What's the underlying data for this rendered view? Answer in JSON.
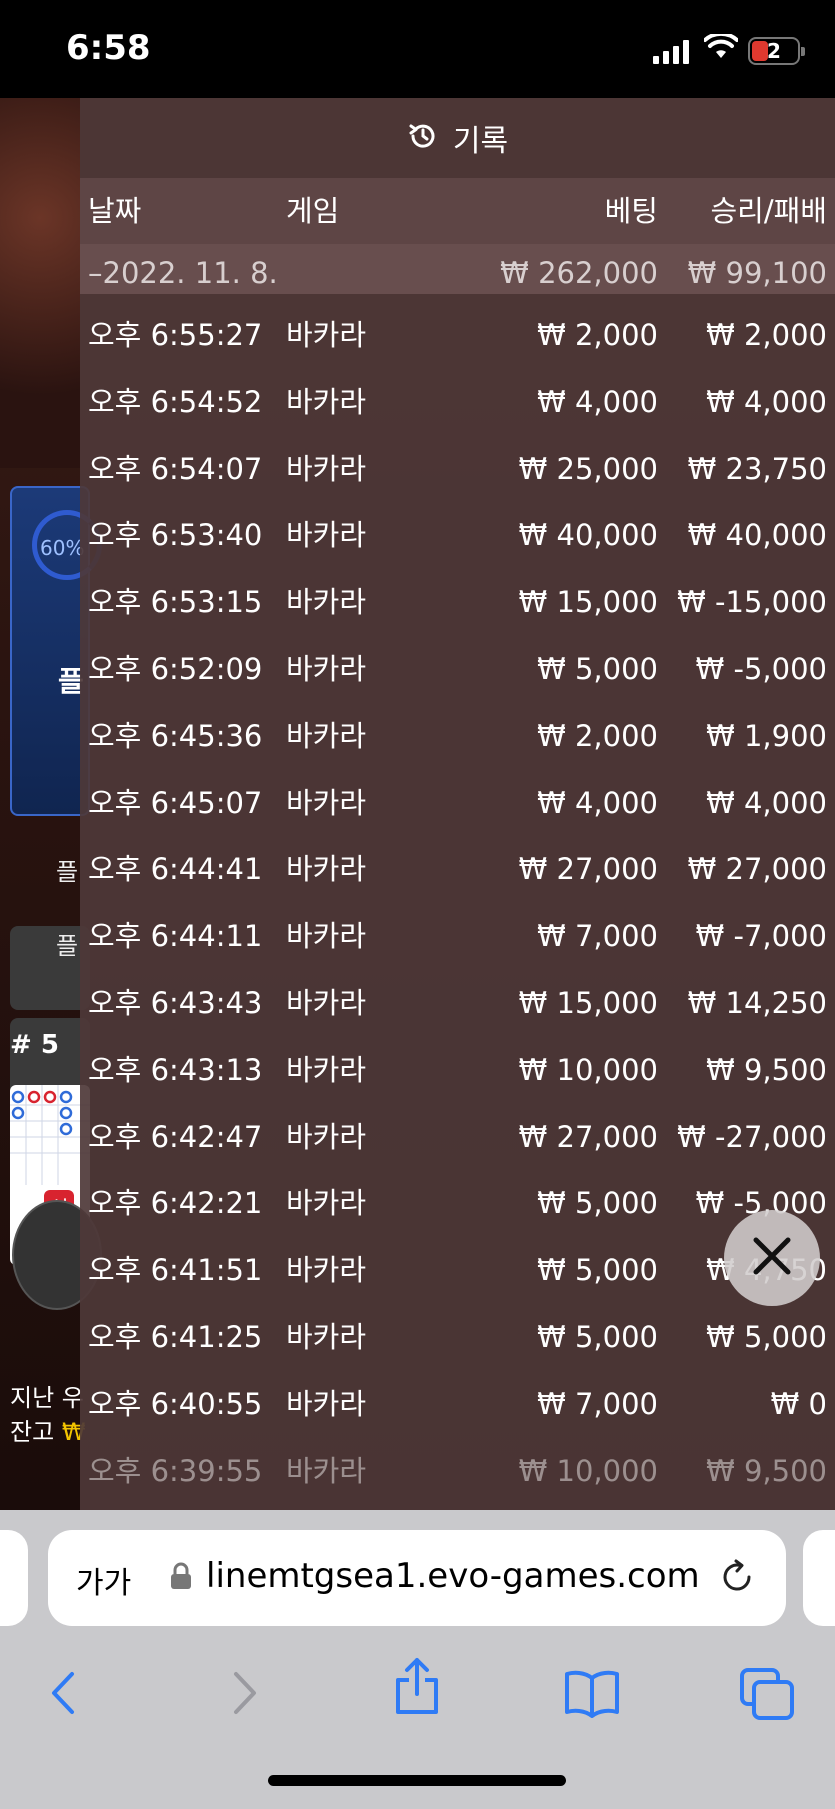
{
  "status_bar": {
    "time": "6:58",
    "battery": "2"
  },
  "game": {
    "progress_label": "60%",
    "panel_label": "플",
    "side_button_1": "플",
    "side_button_2": "플",
    "round_label": "# 5",
    "new_badge": "신",
    "last_win_label": "지난 우",
    "balance_label": "잔고",
    "balance_prefix": "₩"
  },
  "history": {
    "title": "기록",
    "columns": {
      "date": "날짜",
      "game": "게임",
      "bet": "베팅",
      "win_loss": "승리/패배"
    },
    "date_summary": {
      "date": "–2022. 11. 8.",
      "bet": "₩ 262,000",
      "win_loss": "₩ 99,100"
    },
    "rows": [
      {
        "time": "오후 6:55:27",
        "game": "바카라",
        "bet": "₩ 2,000",
        "result": "₩ 2,000"
      },
      {
        "time": "오후 6:54:52",
        "game": "바카라",
        "bet": "₩ 4,000",
        "result": "₩ 4,000"
      },
      {
        "time": "오후 6:54:07",
        "game": "바카라",
        "bet": "₩ 25,000",
        "result": "₩ 23,750"
      },
      {
        "time": "오후 6:53:40",
        "game": "바카라",
        "bet": "₩ 40,000",
        "result": "₩ 40,000"
      },
      {
        "time": "오후 6:53:15",
        "game": "바카라",
        "bet": "₩ 15,000",
        "result": "₩ -15,000"
      },
      {
        "time": "오후 6:52:09",
        "game": "바카라",
        "bet": "₩ 5,000",
        "result": "₩ -5,000"
      },
      {
        "time": "오후 6:45:36",
        "game": "바카라",
        "bet": "₩ 2,000",
        "result": "₩ 1,900"
      },
      {
        "time": "오후 6:45:07",
        "game": "바카라",
        "bet": "₩ 4,000",
        "result": "₩ 4,000"
      },
      {
        "time": "오후 6:44:41",
        "game": "바카라",
        "bet": "₩ 27,000",
        "result": "₩ 27,000"
      },
      {
        "time": "오후 6:44:11",
        "game": "바카라",
        "bet": "₩ 7,000",
        "result": "₩ -7,000"
      },
      {
        "time": "오후 6:43:43",
        "game": "바카라",
        "bet": "₩ 15,000",
        "result": "₩ 14,250"
      },
      {
        "time": "오후 6:43:13",
        "game": "바카라",
        "bet": "₩ 10,000",
        "result": "₩ 9,500"
      },
      {
        "time": "오후 6:42:47",
        "game": "바카라",
        "bet": "₩ 27,000",
        "result": "₩ -27,000"
      },
      {
        "time": "오후 6:42:21",
        "game": "바카라",
        "bet": "₩ 5,000",
        "result": "₩ -5,000"
      },
      {
        "time": "오후 6:41:51",
        "game": "바카라",
        "bet": "₩ 5,000",
        "result": "₩ 4,750"
      },
      {
        "time": "오후 6:41:25",
        "game": "바카라",
        "bet": "₩ 5,000",
        "result": "₩ 5,000"
      },
      {
        "time": "오후 6:40:55",
        "game": "바카라",
        "bet": "₩ 7,000",
        "result": "₩ 0"
      },
      {
        "time": "오후 6:39:55",
        "game": "바카라",
        "bet": "₩ 10,000",
        "result": "₩ 9,500"
      }
    ]
  },
  "browser": {
    "reader_label": "가가",
    "url": "linemtgsea1.evo-games.com"
  },
  "colors": {
    "accent": "#2f7bf5",
    "panel": "#4e3838",
    "badge": "#d8232f"
  }
}
